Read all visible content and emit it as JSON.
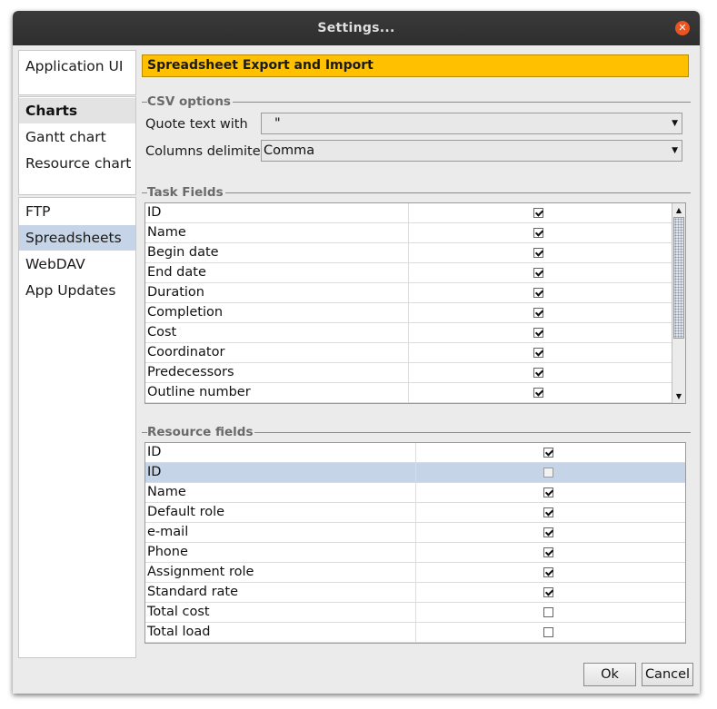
{
  "window": {
    "title": "Settings..."
  },
  "sidebar": {
    "group1": [
      {
        "label": "Application UI"
      }
    ],
    "group2": [
      {
        "label": "Charts",
        "kind": "header"
      },
      {
        "label": "Gantt chart"
      },
      {
        "label": "Resource chart"
      }
    ],
    "group3": [
      {
        "label": "FTP"
      },
      {
        "label": "Spreadsheets",
        "selected": true
      },
      {
        "label": "WebDAV"
      },
      {
        "label": "App Updates"
      }
    ]
  },
  "main": {
    "banner": "Spreadsheet Export and Import",
    "csv": {
      "title": "CSV options",
      "quote_label": "Quote text with",
      "quote_value": "\"",
      "delimiter_label": "Columns delimiter",
      "delimiter_value": "Comma"
    },
    "task_fields": {
      "title": "Task Fields",
      "rows": [
        {
          "name": "ID",
          "checked": true
        },
        {
          "name": "Name",
          "checked": true
        },
        {
          "name": "Begin date",
          "checked": true
        },
        {
          "name": "End date",
          "checked": true
        },
        {
          "name": "Duration",
          "checked": true
        },
        {
          "name": "Completion",
          "checked": true
        },
        {
          "name": "Cost",
          "checked": true
        },
        {
          "name": "Coordinator",
          "checked": true
        },
        {
          "name": "Predecessors",
          "checked": true
        },
        {
          "name": "Outline number",
          "checked": true
        }
      ]
    },
    "resource_fields": {
      "title": "Resource fields",
      "rows": [
        {
          "name": "ID",
          "checked": true
        },
        {
          "name": "ID",
          "checked": false,
          "selected": true
        },
        {
          "name": "Name",
          "checked": true
        },
        {
          "name": "Default role",
          "checked": true
        },
        {
          "name": "e-mail",
          "checked": true
        },
        {
          "name": "Phone",
          "checked": true
        },
        {
          "name": "Assignment role",
          "checked": true
        },
        {
          "name": "Standard rate",
          "checked": true
        },
        {
          "name": "Total cost",
          "checked": false
        },
        {
          "name": "Total load",
          "checked": false
        }
      ]
    }
  },
  "footer": {
    "ok_label": "Ok",
    "cancel_label": "Cancel"
  },
  "colors": {
    "banner": "#ffc000",
    "selection": "#c5d4e6",
    "close": "#e95420"
  }
}
